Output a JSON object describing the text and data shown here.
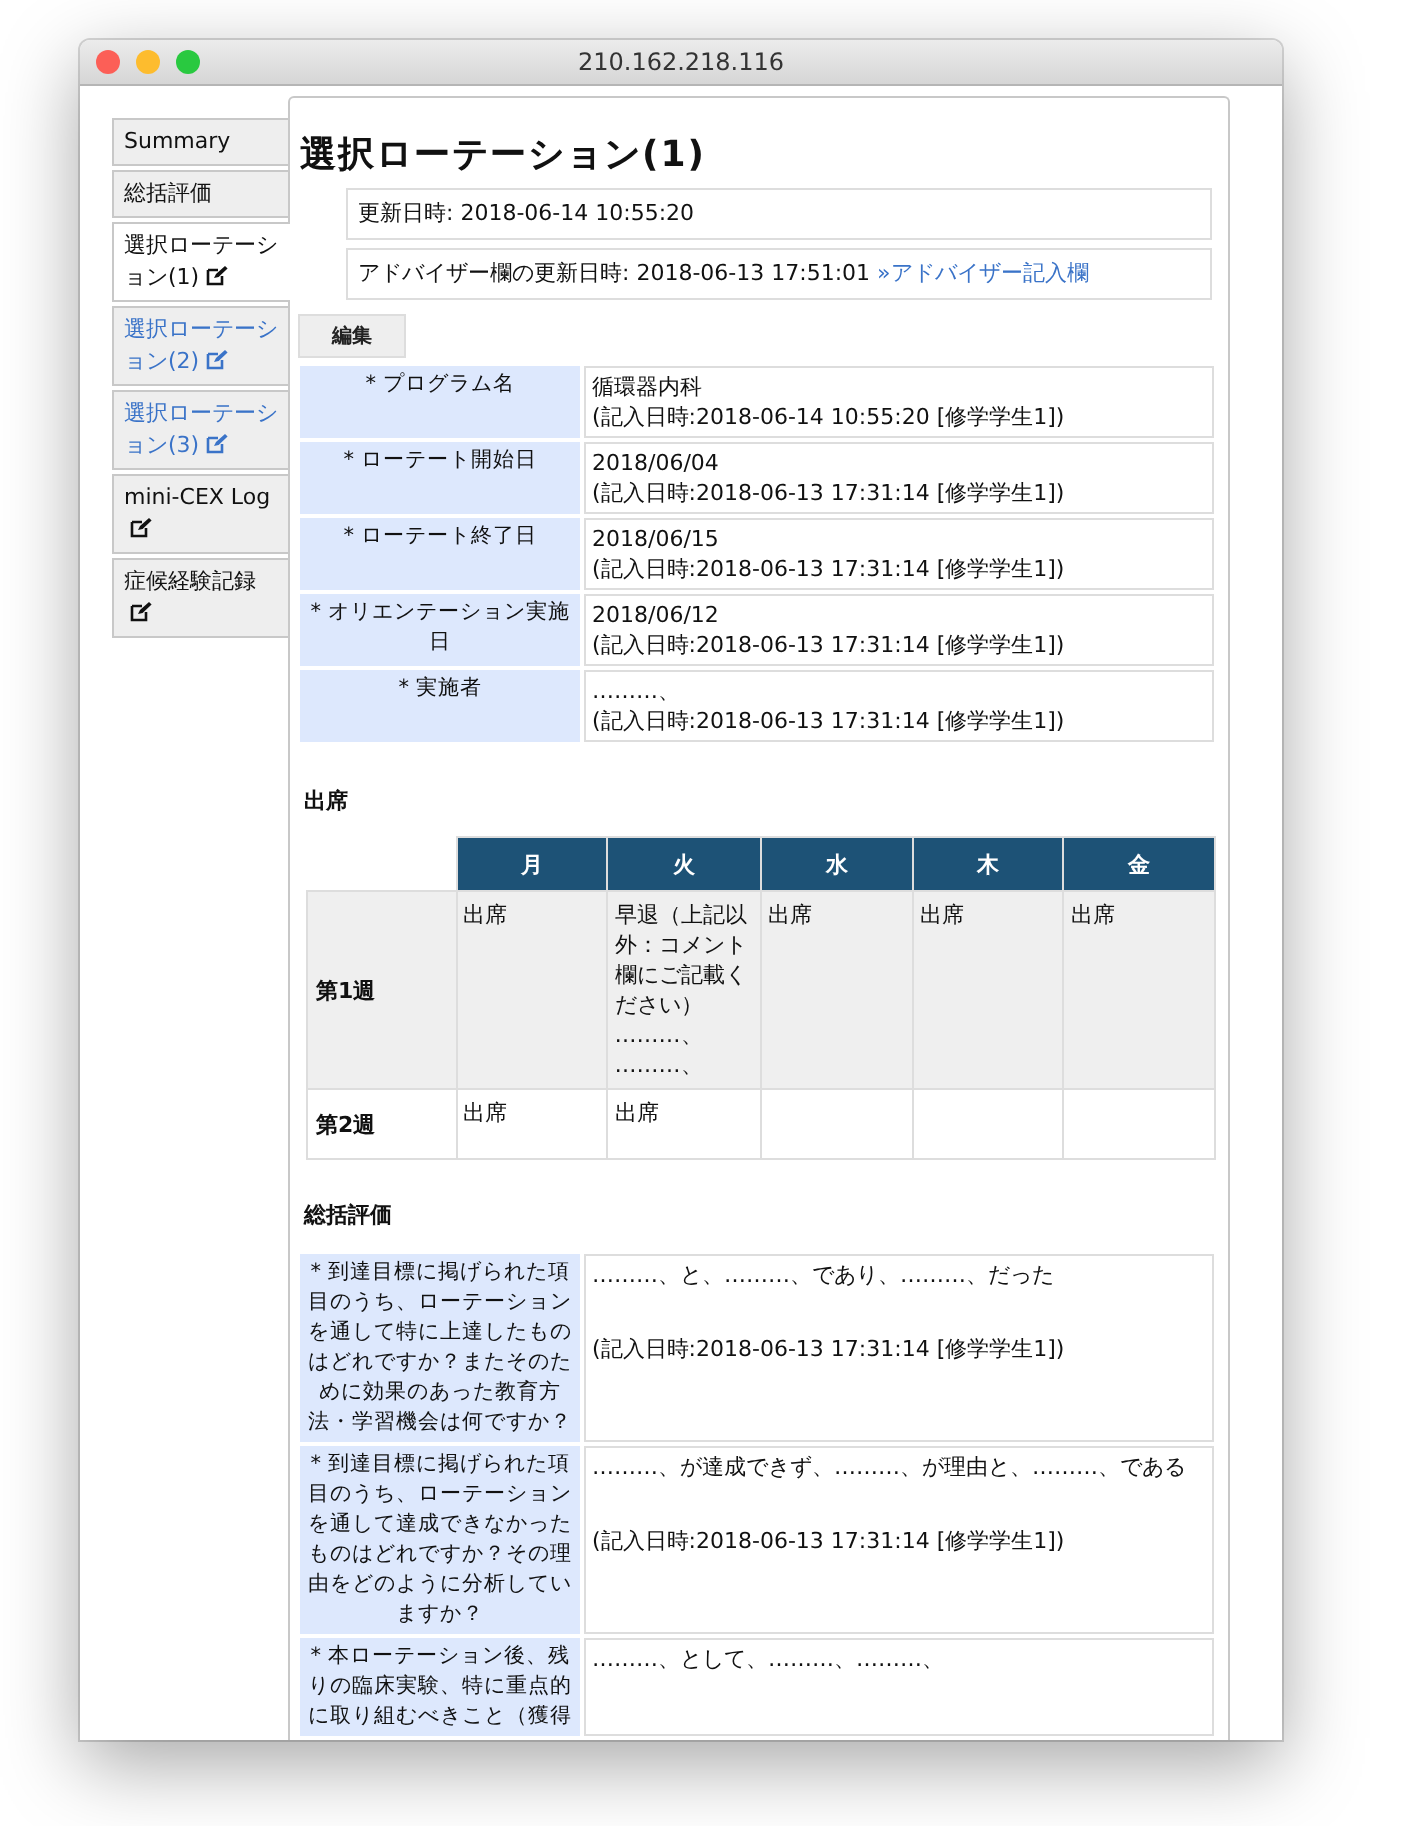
{
  "window": {
    "title": "210.162.218.116"
  },
  "sidebar": {
    "items": [
      {
        "label": "Summary",
        "selected": false,
        "kind": "plain",
        "editable": false
      },
      {
        "label": "総括評価",
        "selected": false,
        "kind": "plain",
        "editable": false
      },
      {
        "label": "選択ローテーション(1)",
        "selected": true,
        "kind": "plain",
        "editable": true
      },
      {
        "label": "選択ローテーション(2)",
        "selected": false,
        "kind": "link",
        "editable": true
      },
      {
        "label": "選択ローテーション(3)",
        "selected": false,
        "kind": "link",
        "editable": true
      },
      {
        "label": "mini-CEX Log",
        "selected": false,
        "kind": "plain",
        "editable": true
      },
      {
        "label": "症候経験記録",
        "selected": false,
        "kind": "plain",
        "editable": true
      }
    ]
  },
  "page": {
    "title": "選択ローテーション(1)",
    "updated": "更新日時: 2018-06-14 10:55:20",
    "advisor_updated": "アドバイザー欄の更新日時: 2018-06-13 17:51:01",
    "advisor_link": "»アドバイザー記入欄",
    "edit_button": "編集"
  },
  "fields": [
    {
      "label": "* プログラム名",
      "value": "循環器内科",
      "record": "(記入日時:2018-06-14 10:55:20 [修学学生1])"
    },
    {
      "label": "* ローテート開始日",
      "value": "2018/06/04",
      "record": "(記入日時:2018-06-13 17:31:14 [修学学生1])"
    },
    {
      "label": "* ローテート終了日",
      "value": "2018/06/15",
      "record": "(記入日時:2018-06-13 17:31:14 [修学学生1])"
    },
    {
      "label": "* オリエンテーション実施日",
      "value": "2018/06/12",
      "record": "(記入日時:2018-06-13 17:31:14 [修学学生1])"
    },
    {
      "label": "* 実施者",
      "value": "………、",
      "record": "(記入日時:2018-06-13 17:31:14 [修学学生1])"
    }
  ],
  "attendance": {
    "heading": "出席",
    "columns": [
      "月",
      "火",
      "水",
      "木",
      "金"
    ],
    "rows": [
      {
        "label": "第1週",
        "cells": [
          [
            "出席"
          ],
          [
            "早退（上記以外：コメント欄にご記載ください）",
            "………、",
            "………、"
          ],
          [
            "出席"
          ],
          [
            "出席"
          ],
          [
            "出席"
          ]
        ]
      },
      {
        "label": "第2週",
        "cells": [
          [
            "出席"
          ],
          [
            "出席"
          ],
          [],
          [],
          []
        ]
      }
    ]
  },
  "summary": {
    "heading": "総括評価",
    "rows": [
      {
        "label": "* 到達目標に掲げられた項目のうち、ローテーションを通して特に上達したものはどれですか？またそのために効果のあった教育方法・学習機会は何ですか？",
        "value": "………、と、………、であり、………、だった",
        "record": "(記入日時:2018-06-13 17:31:14 [修学学生1])"
      },
      {
        "label": "* 到達目標に掲げられた項目のうち、ローテーションを通して達成できなかったものはどれですか？その理由をどのように分析していますか？",
        "value": "………、が達成できず、………、が理由と、………、である",
        "record": "(記入日時:2018-06-13 17:31:14 [修学学生1])"
      },
      {
        "label": "* 本ローテーション後、残りの臨床実験、特に重点的に取り組むべきこと（獲得",
        "value": "………、として、………、………、"
      }
    ]
  }
}
